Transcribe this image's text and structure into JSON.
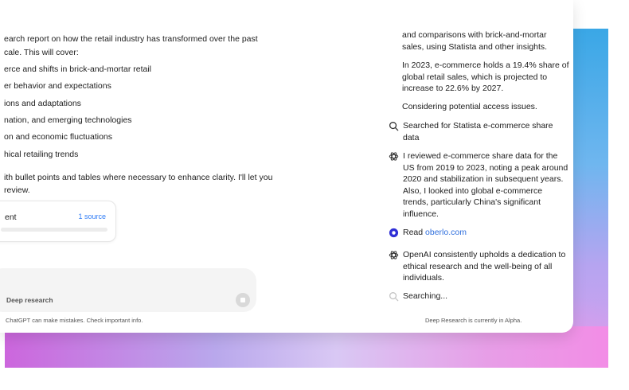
{
  "chat": {
    "message_lines": [
      "earch report on how the retail industry has transformed over the past",
      "cale. This will cover:",
      "erce and shifts in brick-and-mortar retail",
      "er behavior and expectations",
      "ions and adaptations",
      "nation, and emerging technologies",
      "on and economic fluctuations",
      "hical retailing trends",
      "ith bullet points and tables where necessary to enhance clarity. I'll let you",
      "review."
    ],
    "source_card": {
      "title": "ent",
      "count": "1 source"
    },
    "composer": {
      "mode_label": "Deep research"
    },
    "disclaimer": "ChatGPT can make mistakes. Check important info."
  },
  "research": {
    "intro_lines": [
      "and comparisons with brick-and-mortar",
      "sales, using Statista and other insights."
    ],
    "stat_lines": [
      "In 2023, e-commerce holds a 19.4% share of",
      "global retail sales, which is projected to",
      "increase to 22.6% by 2027."
    ],
    "considering": "Considering potential access issues.",
    "activities": [
      {
        "icon": "search-icon",
        "lines": [
          "Searched for Statista e-commerce share",
          "data"
        ]
      },
      {
        "icon": "openai-logo-icon",
        "lines": [
          "I reviewed e-commerce share data for the",
          "US from 2019 to 2023, noting a peak around",
          "2020 and stabilization in subsequent years.",
          "Also, I looked into global e-commerce",
          "trends, particularly China's significant",
          "influence."
        ]
      },
      {
        "icon": "site-favicon-icon",
        "prefix": "Read ",
        "link": "oberlo.com"
      },
      {
        "icon": "openai-logo-icon",
        "lines": [
          "OpenAI consistently upholds a dedication to",
          "ethical research and the well-being of all",
          "individuals."
        ]
      },
      {
        "icon": "search-icon",
        "lines": [
          "Searching..."
        ]
      }
    ],
    "footer_note": "Deep Research is currently in Alpha."
  },
  "colors": {
    "link": "#2f6fdd",
    "favicon": "#2f2fd6",
    "gradient_blue": "#3aa7e6",
    "gradient_pink": "#f28de6"
  }
}
